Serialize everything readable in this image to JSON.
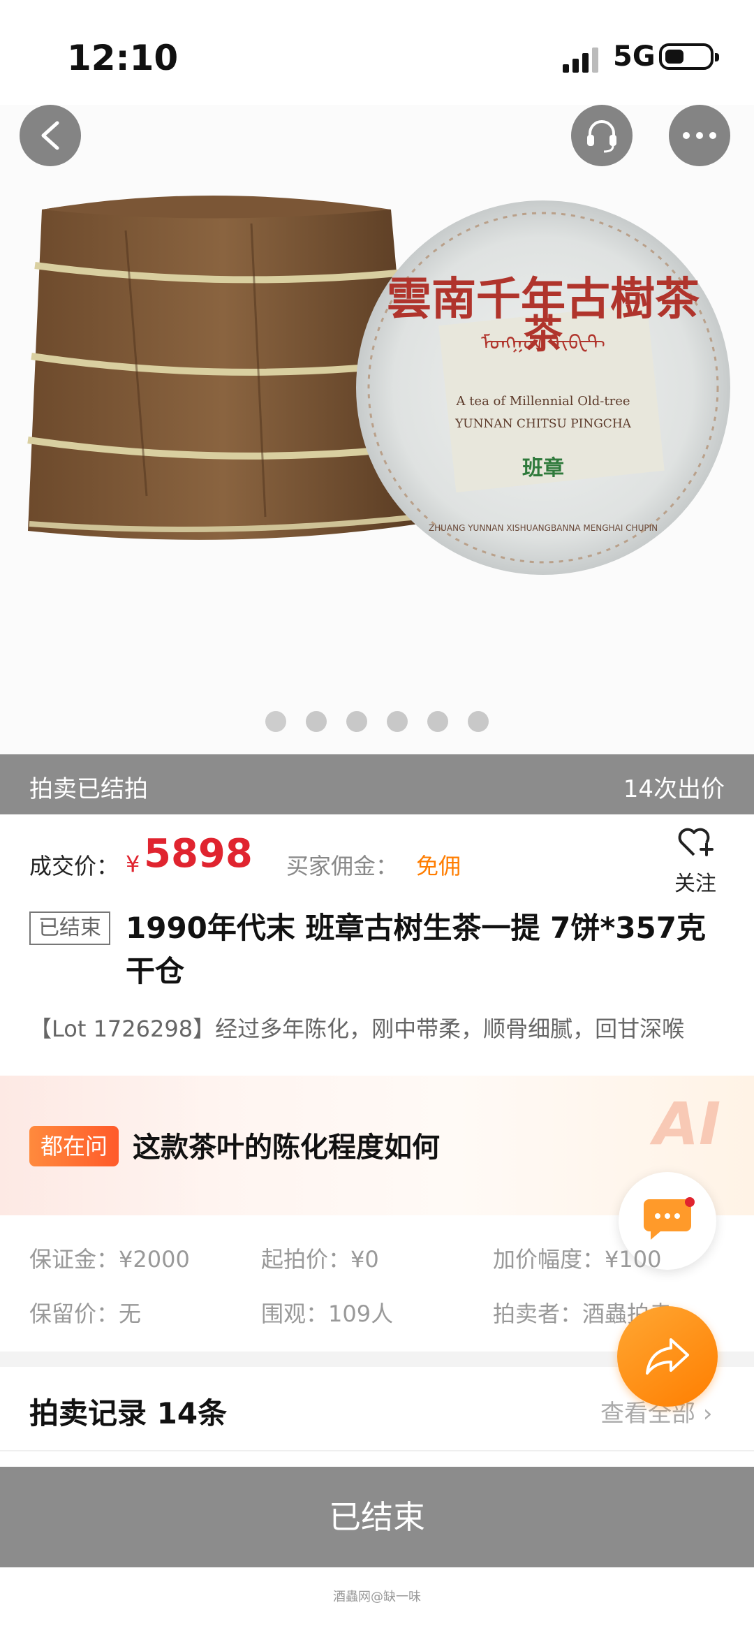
{
  "status_bar": {
    "time": "12:10",
    "network": "5G"
  },
  "hero": {
    "image_alt": "古树茶饼",
    "cake_text_main": "雲南千年古樹茶",
    "cake_text_center": "茶",
    "cake_text_en1": "A tea of Millennial Old-tree",
    "cake_text_en2": "YUNNAN CHITSU PINGCHA",
    "cake_text_stamp": "班章",
    "cake_text_rim": "ZHUANG  YUNNAN XISHUANGBANNA MENGHAI CHUPIN"
  },
  "carousel": {
    "total": 6,
    "active": 0
  },
  "auction_bar": {
    "status": "拍卖已结拍",
    "bids": "14次出价"
  },
  "price": {
    "label": "成交价：",
    "symbol": "¥",
    "value": "5898",
    "commission_label": "买家佣金：",
    "commission_value": "免佣"
  },
  "follow": {
    "label": "关注"
  },
  "lot": {
    "tag": "已结束",
    "title": "1990年代末 班章古树生茶一提 7饼*357克 干仓",
    "desc": "【Lot 1726298】经过多年陈化，刚中带柔，顺骨细腻，回甘深喉"
  },
  "ask": {
    "badge": "都在问",
    "question": "这款茶叶的陈化程度如何",
    "ai_label": "AI"
  },
  "info": [
    {
      "label": "保证金：",
      "value": "¥2000"
    },
    {
      "label": "起拍价：",
      "value": "¥0"
    },
    {
      "label": "加价幅度：",
      "value": "¥100"
    },
    {
      "label": "保留价：",
      "value": "无"
    },
    {
      "label": "围观：",
      "value": "109人"
    },
    {
      "label": "拍卖者：",
      "value": "酒蟲拍卖"
    }
  ],
  "records": {
    "title": "拍卖记录 14条",
    "more": "查看全部"
  },
  "footer": {
    "button": "已结束",
    "watermark": "酒蟲网@缺一味"
  },
  "colors": {
    "price": "#e0242f",
    "commission": "#ff7d00",
    "bar_gray": "#8c8c8c"
  }
}
